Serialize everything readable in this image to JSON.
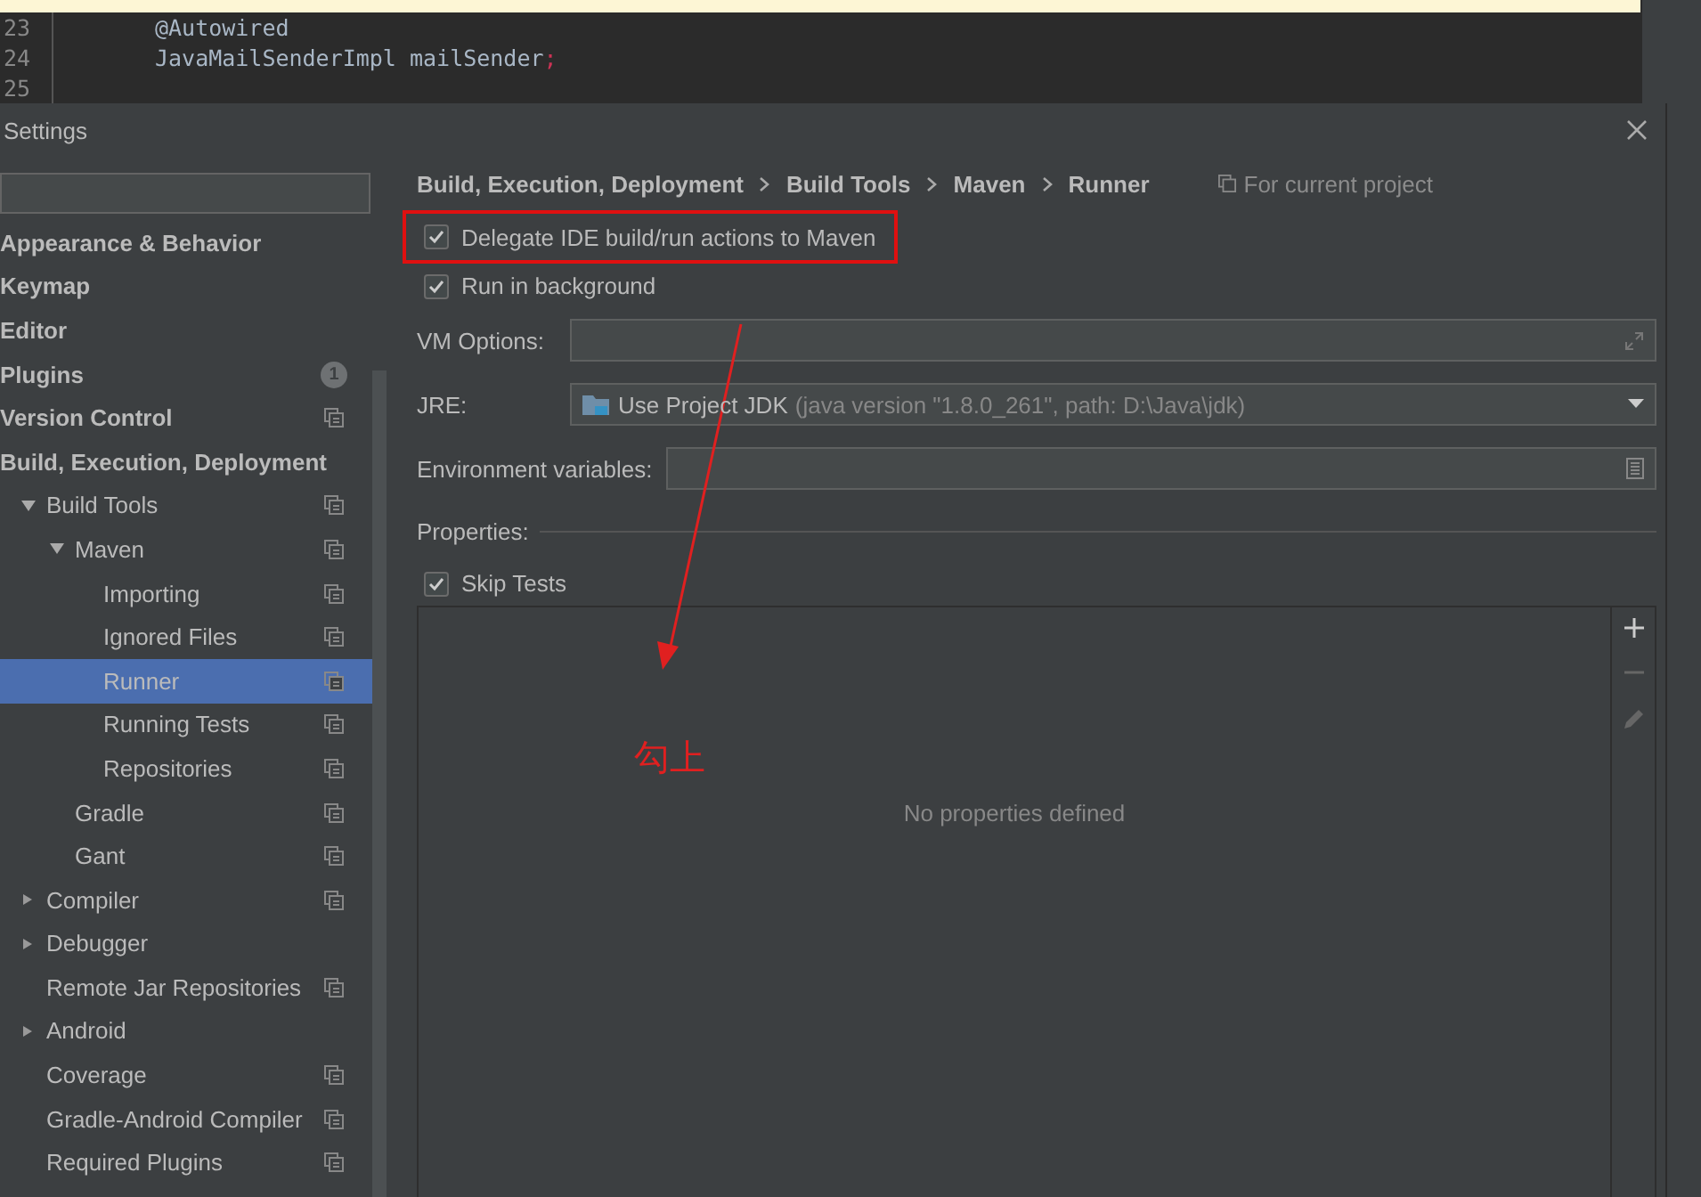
{
  "editor": {
    "lines": [
      {
        "number": "23",
        "code": "@Autowired"
      },
      {
        "number": "24",
        "code": "JavaMailSenderImpl mailSender",
        "punct": ";"
      },
      {
        "number": "25"
      }
    ]
  },
  "window": {
    "title": "Settings"
  },
  "sidebar": {
    "items": [
      {
        "label": "Appearance & Behavior",
        "project_icon": false
      },
      {
        "label": "Keymap",
        "project_icon": false
      },
      {
        "label": "Editor",
        "project_icon": false
      },
      {
        "label": "Plugins",
        "project_icon": false,
        "badge": "1"
      },
      {
        "label": "Version Control",
        "project_icon": true
      },
      {
        "label": "Build, Execution, Deployment",
        "project_icon": false,
        "children": [
          {
            "label": "Build Tools",
            "expanded": true,
            "project_icon": true,
            "children": [
              {
                "label": "Maven",
                "expanded": true,
                "project_icon": true,
                "children": [
                  {
                    "label": "Importing",
                    "project_icon": true,
                    "selected": false
                  },
                  {
                    "label": "Ignored Files",
                    "project_icon": true,
                    "selected": false
                  },
                  {
                    "label": "Runner",
                    "project_icon": true,
                    "selected": true
                  },
                  {
                    "label": "Running Tests",
                    "project_icon": true,
                    "selected": false
                  },
                  {
                    "label": "Repositories",
                    "project_icon": true,
                    "selected": false
                  }
                ]
              },
              {
                "label": "Gradle",
                "project_icon": true
              },
              {
                "label": "Gant",
                "project_icon": true
              }
            ]
          },
          {
            "label": "Compiler",
            "expanded": false,
            "project_icon": true
          },
          {
            "label": "Debugger",
            "expanded": false,
            "project_icon": false
          },
          {
            "label": "Remote Jar Repositories",
            "project_icon": true
          },
          {
            "label": "Android",
            "expanded": false,
            "project_icon": false
          },
          {
            "label": "Coverage",
            "project_icon": true
          },
          {
            "label": "Gradle-Android Compiler",
            "project_icon": true
          },
          {
            "label": "Required Plugins",
            "project_icon": true
          }
        ]
      }
    ]
  },
  "breadcrumb": [
    "Build, Execution, Deployment",
    "Build Tools",
    "Maven",
    "Runner"
  ],
  "scope_note": "For current project",
  "options": [
    {
      "label": "Delegate IDE build/run actions to Maven",
      "checked": true,
      "highlighted": true
    },
    {
      "label": "Run in background",
      "checked": true,
      "highlighted": false
    }
  ],
  "fields": [
    {
      "kind": "expand",
      "label": "VM Options:"
    },
    {
      "kind": "select",
      "label": "JRE:",
      "value": "Use Project JDK",
      "detail": "(java version \"1.8.0_261\", path: D:\\Java\\jdk)"
    },
    {
      "kind": "list",
      "label": "Environment variables:"
    }
  ],
  "properties": {
    "title": "Properties:",
    "skip_tests": {
      "label": "Skip Tests",
      "checked": true
    },
    "empty_text": "No properties defined"
  },
  "annotation": {
    "text": "勾上"
  }
}
